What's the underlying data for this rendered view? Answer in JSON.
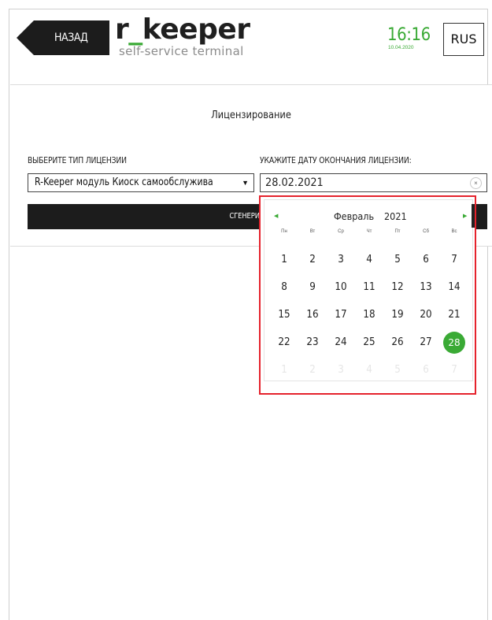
{
  "header": {
    "back_label": "НАЗАД",
    "logo_prefix": "r",
    "logo_underscore": "_",
    "logo_suffix": "keeper",
    "logo_subtitle": "self-service terminal",
    "time": "16:16",
    "date": "10.04.2020",
    "language": "RUS"
  },
  "license": {
    "title": "Лицензирование",
    "type_label": "ВЫБЕРИТЕ ТИП ЛИЦЕНЗИИ",
    "type_value": "R-Keeper модуль Киоск самообслужива",
    "date_label": "УКАЖИТЕ ДАТУ ОКОНЧАНИЯ ЛИЦЕНЗИИ:",
    "date_value": "28.02.2021",
    "clear_symbol": "×",
    "generate_label": "СГЕНЕРИРОВАТЬ"
  },
  "calendar": {
    "month": "Февраль",
    "year": "2021",
    "weekdays": [
      "Пн",
      "Вт",
      "Ср",
      "Чт",
      "Пт",
      "Сб",
      "Вс"
    ],
    "days": [
      "1",
      "2",
      "3",
      "4",
      "5",
      "6",
      "7",
      "8",
      "9",
      "10",
      "11",
      "12",
      "13",
      "14",
      "15",
      "16",
      "17",
      "18",
      "19",
      "20",
      "21",
      "22",
      "23",
      "24",
      "25",
      "26",
      "27",
      "28"
    ],
    "next_month_days": [
      "1",
      "2",
      "3",
      "4",
      "5",
      "6",
      "7"
    ],
    "selected_day": "28"
  },
  "colors": {
    "accent": "#3aaa35",
    "dark": "#1c1c1c",
    "highlight": "#e5222c"
  }
}
